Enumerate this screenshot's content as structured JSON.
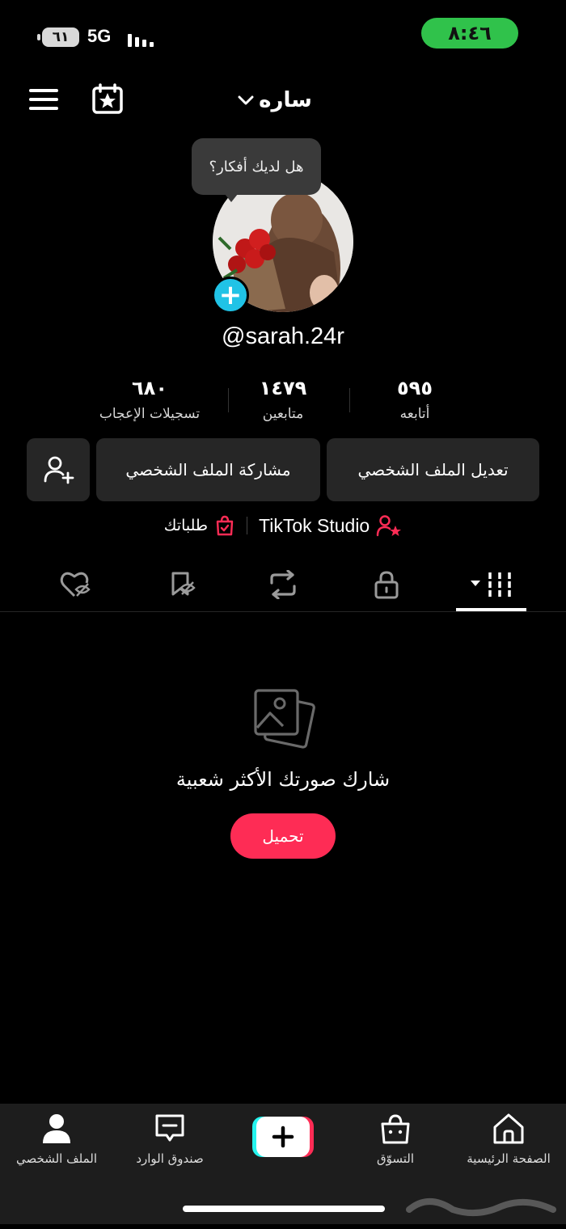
{
  "status_bar": {
    "battery": "٦١",
    "network": "5G",
    "time": "٨:٤٦"
  },
  "header": {
    "title": "ساره",
    "menu_icon": "hamburger-menu-icon",
    "calendar_icon": "calendar-star-icon"
  },
  "profile": {
    "bubble_text": "هل لديك أفكار؟",
    "handle": "@sarah.24r",
    "stats": [
      {
        "value": "٥٩٥",
        "label": "أتابعه"
      },
      {
        "value": "١٤٧٩",
        "label": "متابعين"
      },
      {
        "value": "٦٨٠",
        "label": "تسجيلات الإعجاب"
      }
    ],
    "buttons": {
      "edit": "تعديل الملف الشخصي",
      "share": "مشاركة الملف الشخصي"
    },
    "studio_label": "TikTok Studio",
    "orders_label": "طلباتك"
  },
  "empty_state": {
    "title": "شارك صورتك الأكثر شعبية",
    "upload_label": "تحميل"
  },
  "bottom_nav": {
    "home": "الصفحة الرئيسية",
    "shop": "التسوّق",
    "inbox": "صندوق الوارد",
    "profile": "الملف الشخصي"
  },
  "colors": {
    "accent": "#fe2c55",
    "time_pill": "#30c24b",
    "avatar_add": "#20c3e6"
  }
}
